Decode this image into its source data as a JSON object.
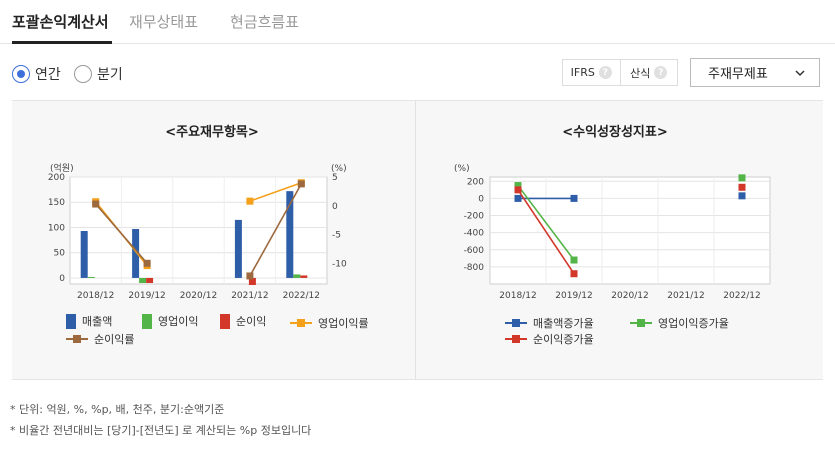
{
  "tabs": [
    {
      "label": "포괄손익계산서",
      "active": true
    },
    {
      "label": "재무상태표",
      "active": false
    },
    {
      "label": "현금흐름표",
      "active": false
    }
  ],
  "period": {
    "options": [
      {
        "label": "연간",
        "checked": true
      },
      {
        "label": "분기",
        "checked": false
      }
    ]
  },
  "info": [
    {
      "label": "IFRS",
      "icon": "question-icon",
      "icon_text": "?"
    },
    {
      "label": "산식",
      "icon": "question-icon",
      "icon_text": "?"
    }
  ],
  "statement_select": {
    "value": "주재무제표"
  },
  "colors": {
    "blue": "#2f5ea8",
    "green": "#53b448",
    "red": "#d2372a",
    "orange": "#f4a019",
    "brown": "#9c6a3e",
    "radio_accent": "#3e70d9"
  },
  "charts": {
    "left": {
      "title": "<주요재무항목>"
    },
    "right": {
      "title": "<수익성장성지표>"
    }
  },
  "chart_data": [
    {
      "type": "bar",
      "title": "<주요재무항목>",
      "categories": [
        "2018/12",
        "2019/12",
        "2020/12",
        "2021/12",
        "2022/12"
      ],
      "y_left": {
        "label": "(억원)",
        "ticks": [
          0,
          50,
          100,
          150,
          200
        ],
        "lim": [
          -12,
          200
        ]
      },
      "y_right": {
        "label": "(%)",
        "ticks": [
          5,
          0,
          -5,
          -10
        ],
        "lim": [
          -13.6,
          5
        ]
      },
      "grid": true,
      "legend_position": "bottom",
      "series": [
        {
          "name": "매출액",
          "kind": "bar",
          "axis": "left",
          "color": "#2f5ea8",
          "values": [
            93,
            97,
            null,
            115,
            172
          ]
        },
        {
          "name": "영업이익",
          "kind": "bar",
          "axis": "left",
          "color": "#53b448",
          "values": [
            2,
            -10,
            null,
            null,
            7
          ]
        },
        {
          "name": "순이익",
          "kind": "bar",
          "axis": "left",
          "color": "#d2372a",
          "values": [
            null,
            -10,
            null,
            -14,
            5
          ]
        },
        {
          "name": "영업이익률",
          "kind": "line",
          "axis": "right",
          "color": "#f4a019",
          "values": [
            0.7,
            -10.4,
            null,
            0.8,
            4.0
          ]
        },
        {
          "name": "순이익률",
          "kind": "line",
          "axis": "right",
          "color": "#9c6a3e",
          "values": [
            0.3,
            -10.0,
            null,
            -12.2,
            3.8
          ]
        }
      ]
    },
    {
      "type": "line",
      "title": "<수익성장성지표>",
      "categories": [
        "2018/12",
        "2019/12",
        "2020/12",
        "2021/12",
        "2022/12"
      ],
      "y": {
        "label": "(%)",
        "ticks": [
          200,
          0,
          -200,
          -400,
          -600,
          -800
        ],
        "lim": [
          -1000,
          250
        ]
      },
      "grid": true,
      "legend_position": "bottom",
      "series": [
        {
          "name": "매출액증가율",
          "color": "#2f5ea8",
          "values": [
            0,
            0,
            null,
            null,
            30
          ]
        },
        {
          "name": "영업이익증가율",
          "color": "#53b448",
          "values": [
            150,
            -720,
            null,
            null,
            240
          ]
        },
        {
          "name": "순이익증가율",
          "color": "#d2372a",
          "values": [
            100,
            -880,
            null,
            null,
            130
          ]
        }
      ]
    }
  ],
  "notes": [
    "* 단위: 억원, %, %p, 배, 천주, 분기:순액기준",
    "* 비율간 전년대비는 [당기]-[전년도] 로 계산되는 %p 정보입니다"
  ]
}
